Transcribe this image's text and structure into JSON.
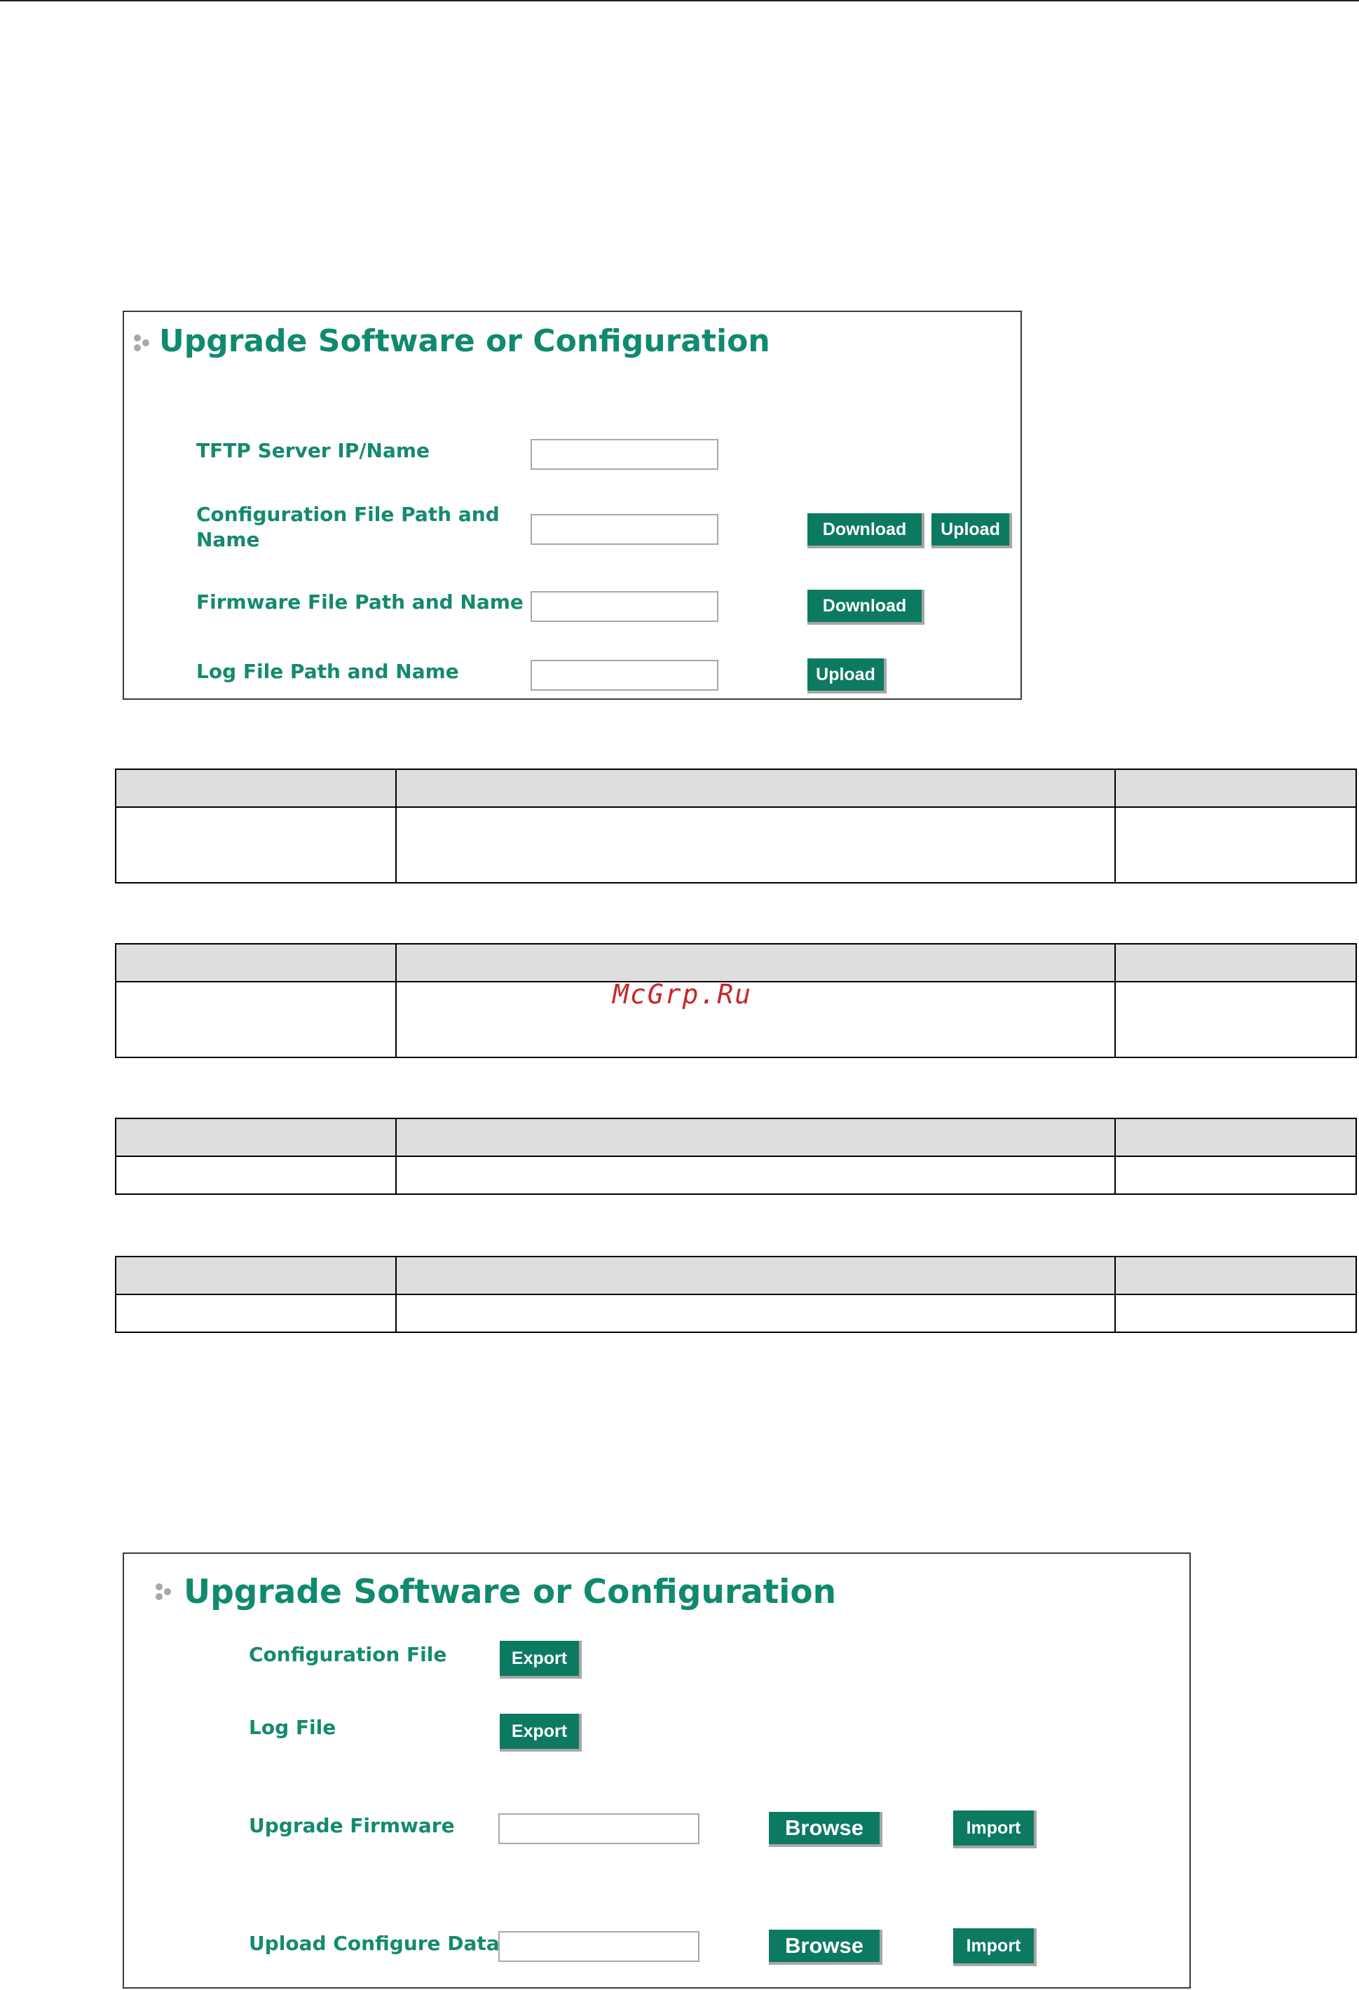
{
  "panel1": {
    "title": "Upgrade Software or Configuration",
    "tftp_label": "TFTP Server IP/Name",
    "tftp_value": "",
    "config_label_line1": "Configuration File Path and",
    "config_label_line2": "Name",
    "config_value": "",
    "config_download_label": "Download",
    "config_upload_label": "Upload",
    "firmware_label": "Firmware File Path and Name",
    "firmware_value": "",
    "firmware_download_label": "Download",
    "log_label": "Log File Path and Name",
    "log_value": "",
    "log_upload_label": "Upload"
  },
  "tables": [
    {
      "header": [
        "",
        "",
        ""
      ],
      "rows": [
        [
          "",
          "",
          ""
        ]
      ]
    },
    {
      "header": [
        "",
        "",
        ""
      ],
      "rows": [
        [
          "",
          "",
          ""
        ]
      ]
    },
    {
      "header": [
        "",
        "",
        ""
      ],
      "rows": [
        [
          "",
          "",
          ""
        ]
      ]
    },
    {
      "header": [
        "",
        "",
        ""
      ],
      "rows": [
        [
          "",
          "",
          ""
        ]
      ]
    }
  ],
  "watermark": "McGrp.Ru",
  "panel2": {
    "title": "Upgrade Software or Configuration",
    "config_file_label": "Configuration File",
    "config_export_label": "Export",
    "log_file_label": "Log File",
    "log_export_label": "Export",
    "upgrade_firmware_label": "Upgrade Firmware",
    "upgrade_firmware_value": "",
    "upgrade_firmware_browse_label": "Browse",
    "upgrade_firmware_import_label": "Import",
    "upload_config_label": "Upload Configure Data",
    "upload_config_value": "",
    "upload_config_browse_label": "Browse",
    "upload_config_import_label": "Import"
  },
  "colors": {
    "accent": "#108a6e",
    "button": "#0b7a60",
    "watermark": "#c8262a",
    "table_header": "#dedede"
  }
}
